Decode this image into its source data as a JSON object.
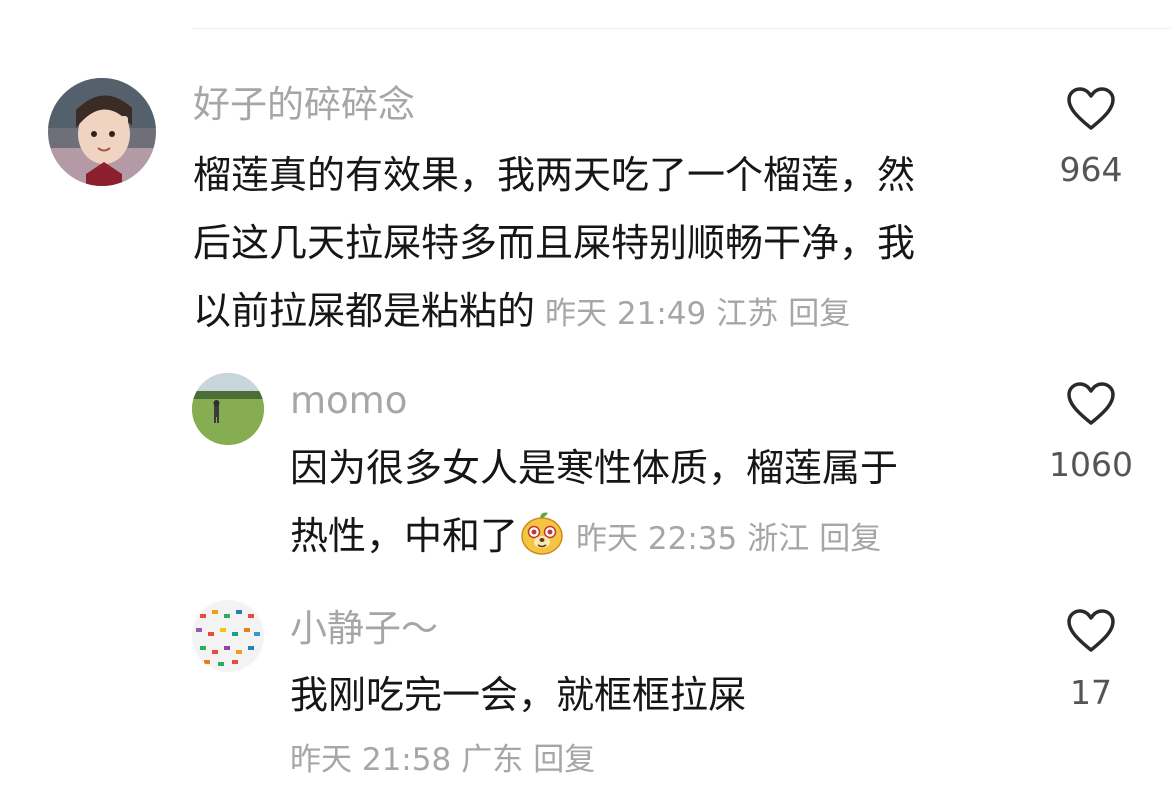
{
  "comments": [
    {
      "username": "好子的碎碎念",
      "lines": [
        "榴莲真的有效果，我两天吃了一个榴莲，然",
        "后这几天拉屎特多而且屎特别顺畅干净，我",
        "以前拉屎都是粘粘的"
      ],
      "time": "昨天 21:49",
      "location": "江苏",
      "reply_label": "回复",
      "like_count": "964",
      "avatar_icon": "avatar-girl-photo"
    },
    {
      "username": "momo",
      "lines": [
        "因为很多女人是寒性体质，榴莲属于",
        "热性，中和了"
      ],
      "emoji": "yellow-dog-emoji",
      "time": "昨天 22:35",
      "location": "浙江",
      "reply_label": "回复",
      "like_count": "1060",
      "avatar_icon": "avatar-grass-field-photo"
    },
    {
      "username": "小静子～",
      "lines": [
        "我刚吃完一会，就框框拉屎"
      ],
      "time": "昨天 21:58",
      "location": "广东",
      "reply_label": "回复",
      "like_count": "17",
      "avatar_icon": "avatar-colorful-pattern"
    }
  ],
  "colors": {
    "text_primary": "#161616",
    "text_secondary": "#a6a6a6",
    "like_count": "#555555"
  }
}
